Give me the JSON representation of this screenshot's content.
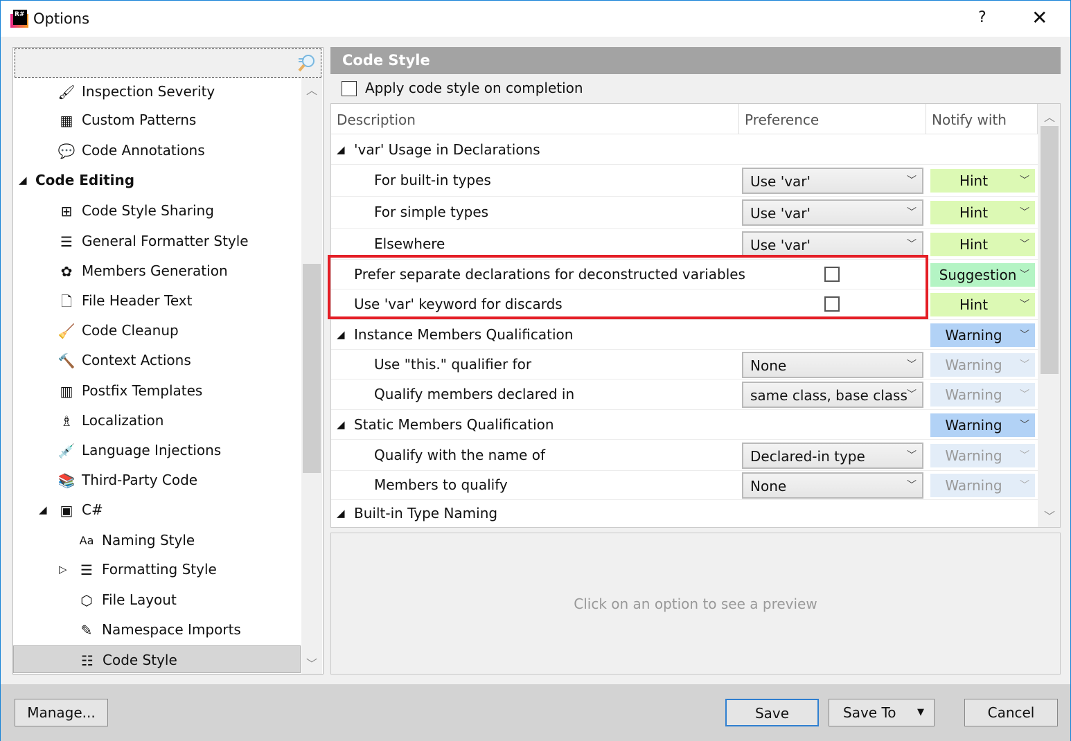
{
  "window": {
    "title": "Options",
    "help": "?",
    "close": "✕"
  },
  "search": {
    "value": "",
    "placeholder": ""
  },
  "tree": [
    {
      "label": "Inspection Severity",
      "icon": "inspection-severity-icon",
      "glyph": "🖌",
      "level": 1
    },
    {
      "label": "Custom Patterns",
      "icon": "custom-patterns-icon",
      "glyph": "▦",
      "level": 1
    },
    {
      "label": "Code Annotations",
      "icon": "code-annotations-icon",
      "glyph": "💬",
      "level": 1
    },
    {
      "label": "Code Editing",
      "icon": "",
      "level": 0,
      "bold": true,
      "expanded": true
    },
    {
      "label": "Code Style Sharing",
      "icon": "code-style-sharing-icon",
      "glyph": "⊞",
      "level": 1
    },
    {
      "label": "General Formatter Style",
      "icon": "formatter-style-icon",
      "glyph": "☰",
      "level": 1
    },
    {
      "label": "Members Generation",
      "icon": "members-generation-icon",
      "glyph": "✿",
      "level": 1
    },
    {
      "label": "File Header Text",
      "icon": "file-header-icon",
      "glyph": "🗋",
      "level": 1
    },
    {
      "label": "Code Cleanup",
      "icon": "code-cleanup-icon",
      "glyph": "🧹",
      "level": 1
    },
    {
      "label": "Context Actions",
      "icon": "context-actions-icon",
      "glyph": "🔨",
      "level": 1
    },
    {
      "label": "Postfix Templates",
      "icon": "postfix-templates-icon",
      "glyph": "▥",
      "level": 1
    },
    {
      "label": "Localization",
      "icon": "localization-icon",
      "glyph": "♗",
      "level": 1
    },
    {
      "label": "Language Injections",
      "icon": "language-injections-icon",
      "glyph": "💉",
      "level": 1
    },
    {
      "label": "Third-Party Code",
      "icon": "third-party-code-icon",
      "glyph": "📚",
      "level": 1
    },
    {
      "label": "C#",
      "icon": "csharp-icon",
      "glyph": "▣",
      "level": 1,
      "expanded": true
    },
    {
      "label": "Naming Style",
      "icon": "naming-style-icon",
      "glyph": "Aa",
      "level": 2
    },
    {
      "label": "Formatting Style",
      "icon": "formatting-style-icon",
      "glyph": "☰",
      "level": 2,
      "collapsed": true
    },
    {
      "label": "File Layout",
      "icon": "file-layout-icon",
      "glyph": "⬡",
      "level": 2
    },
    {
      "label": "Namespace Imports",
      "icon": "namespace-imports-icon",
      "glyph": "✎",
      "level": 2
    },
    {
      "label": "Code Style",
      "icon": "code-style-icon",
      "glyph": "☷",
      "level": 2,
      "selected": true
    }
  ],
  "panel": {
    "title": "Code Style",
    "apply_label": "Apply code style on completion",
    "apply_checked": false
  },
  "columns": [
    "Description",
    "Preference",
    "Notify with"
  ],
  "rows": [
    {
      "type": "group",
      "label": "'var' Usage in Declarations"
    },
    {
      "label": "For built-in types",
      "pref": "Use 'var'",
      "notify": "Hint",
      "sev": "hint"
    },
    {
      "label": "For simple types",
      "pref": "Use 'var'",
      "notify": "Hint",
      "sev": "hint"
    },
    {
      "label": "Elsewhere",
      "pref": "Use 'var'",
      "notify": "Hint",
      "sev": "hint"
    },
    {
      "label": "Prefer separate declarations for deconstructed variables",
      "checkbox": false,
      "notify": "Suggestion",
      "sev": "suggestion",
      "top": true
    },
    {
      "label": "Use 'var' keyword for discards",
      "checkbox": false,
      "notify": "Hint",
      "sev": "hint",
      "top": true
    },
    {
      "type": "group",
      "label": "Instance Members Qualification",
      "notify": "Warning",
      "sev": "warning"
    },
    {
      "label": "Use \"this.\" qualifier for",
      "pref": "None",
      "notify": "Warning",
      "sev": "warning-dim"
    },
    {
      "label": "Qualify members declared in",
      "pref": "same class, base class",
      "notify": "Warning",
      "sev": "warning-dim"
    },
    {
      "type": "group",
      "label": "Static Members Qualification",
      "notify": "Warning",
      "sev": "warning"
    },
    {
      "label": "Qualify with the name of",
      "pref": "Declared-in type",
      "notify": "Warning",
      "sev": "warning-dim"
    },
    {
      "label": "Members to qualify",
      "pref": "None",
      "notify": "Warning",
      "sev": "warning-dim"
    },
    {
      "type": "group",
      "label": "Built-in Type Naming"
    }
  ],
  "colors": {
    "hint": "#dcf9b4",
    "suggestion": "#b4f4c4",
    "warning": "#b2d2f6",
    "warning-dim": "#e3edf8",
    "highlight": "#e41e26"
  },
  "preview": {
    "text": "Click on an option to see a preview"
  },
  "footer": {
    "manage": "Manage...",
    "save": "Save",
    "save_to": "Save To",
    "cancel": "Cancel"
  }
}
